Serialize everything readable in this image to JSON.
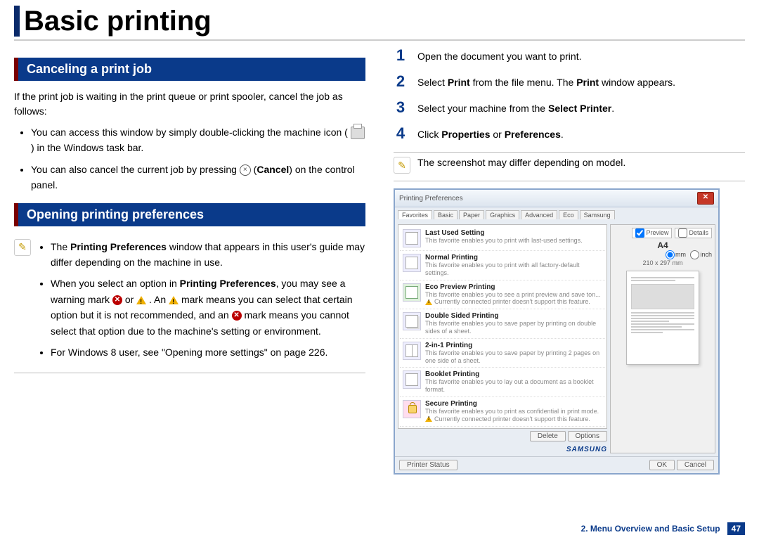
{
  "page_title": "Basic printing",
  "section1_title": "Canceling a print job",
  "section1_intro": "If the print job is waiting in the print queue or print spooler, cancel the job as follows:",
  "section1_bullet1a": "You can access this window by simply double-clicking the machine icon (",
  "section1_bullet1b": ") in the Windows task bar.",
  "section1_bullet2a": "You can also cancel the current job by pressing ",
  "section1_bullet2b": " (",
  "section1_bullet2c": "Cancel",
  "section1_bullet2d": ") on the control panel.",
  "section2_title": "Opening printing preferences",
  "note1_b1a": "The ",
  "note1_b1b": "Printing Preferences",
  "note1_b1c": " window that appears in this user's guide may differ depending on the machine in use.",
  "note1_b2a": "When you select an option in ",
  "note1_b2b": "Printing Preferences",
  "note1_b2c": ", you may see a warning mark ",
  "note1_b2d": " or ",
  "note1_b2e": ". An ",
  "note1_b2f": " mark means you can select that certain option but it is not recommended, and an ",
  "note1_b2g": " mark means you cannot select that option due to the machine's setting or environment.",
  "note1_b3": "For Windows 8 user, see \"Opening more settings\" on page 226.",
  "steps": [
    {
      "num": "1",
      "text": "Open the document you want to print."
    },
    {
      "num": "2",
      "pre": "Select ",
      "b1": "Print",
      "mid": " from the file menu. The ",
      "b2": "Print",
      "post": " window appears."
    },
    {
      "num": "3",
      "pre": "Select your machine from the ",
      "b1": "Select Printer",
      "post": "."
    },
    {
      "num": "4",
      "pre": "Click ",
      "b1": "Properties",
      "mid": " or ",
      "b2": "Preferences",
      "post": "."
    }
  ],
  "note2_text": "The screenshot may differ depending on model.",
  "dialog": {
    "title": "Printing Preferences",
    "tabs": [
      "Favorites",
      "Basic",
      "Paper",
      "Graphics",
      "Advanced",
      "Eco",
      "Samsung"
    ],
    "favorites": [
      {
        "title": "Last Used Setting",
        "desc": "This favorite enables you to print with last-used settings.",
        "thumb": "thumb-used"
      },
      {
        "title": "Normal Printing",
        "desc": "This favorite enables you to print with all factory-default settings.",
        "thumb": "thumb-normal"
      },
      {
        "title": "Eco Preview Printing",
        "desc": "This favorite enables you to see a print preview and save ton...",
        "warn": true,
        "subwarn": "Currently connected printer doesn't support this feature.",
        "thumb": "thumb-eco"
      },
      {
        "title": "Double Sided Printing",
        "desc": "This favorite enables you to save paper by printing on double sides of a sheet.",
        "thumb": "thumb-double"
      },
      {
        "title": "2-in-1 Printing",
        "desc": "This favorite enables you to save paper by printing 2 pages on one side of a sheet.",
        "thumb": "thumb-2in1"
      },
      {
        "title": "Booklet Printing",
        "desc": "This favorite enables you to lay out a document as a booklet format.",
        "thumb": "thumb-booklet"
      },
      {
        "title": "Secure Printing",
        "desc": "This favorite enables you to print as confidential in print mode.",
        "warn": true,
        "subwarn": "Currently connected printer doesn't support this feature.",
        "thumb": "thumb-secure"
      }
    ],
    "delete_btn": "Delete",
    "options_btn": "Options",
    "preview_tab": "Preview",
    "details_tab": "Details",
    "paper_name": "A4",
    "paper_dim": "210 x 297 mm",
    "unit_mm": "mm",
    "unit_inch": "inch",
    "brand": "SAMSUNG",
    "printer_status": "Printer Status",
    "ok": "OK",
    "cancel": "Cancel"
  },
  "footer": {
    "chapter": "2. Menu Overview and Basic Setup",
    "page": "47"
  }
}
